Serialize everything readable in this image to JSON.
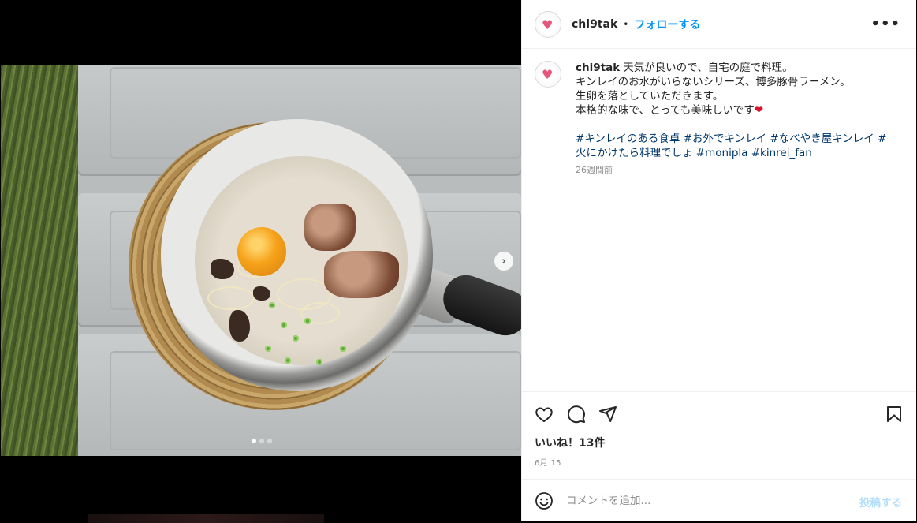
{
  "post": {
    "username": "chi9tak",
    "separator": "•",
    "follow_label": "フォローする",
    "more_icon": "•••"
  },
  "caption": {
    "username": "chi9tak",
    "lines": [
      "天気が良いので、自宅の庭で料理。",
      "キンレイのお水がいらないシリーズ、博多豚骨ラーメン。",
      "生卵を落としていただきます。",
      "本格的な味で、とっても美味しいです"
    ],
    "heart": "❤",
    "tags_line1": "#キンレイのある食卓 #お外でキンレイ #なべやき屋キンレイ #",
    "tags_line2": "火にかけたら料理でしょ #monipla #kinrei_fan",
    "time_ago": "26週間前"
  },
  "actions": {
    "like_icon": "heart-outline-icon",
    "comment_icon": "comment-bubble-icon",
    "share_icon": "paper-plane-icon",
    "save_icon": "bookmark-icon"
  },
  "likes_label": "いいね！13件",
  "date_label": "6月 15",
  "comment_box": {
    "placeholder": "コメントを追加...",
    "post_label": "投稿する"
  },
  "carousel": {
    "next_label": "›",
    "slide_count": 3,
    "active_slide": 1
  },
  "colors": {
    "accent": "#0095f6",
    "post_disabled": "#b2dffc",
    "hashtag": "#00376b",
    "meta": "#8e8e8e",
    "heart": "#d9142f"
  }
}
